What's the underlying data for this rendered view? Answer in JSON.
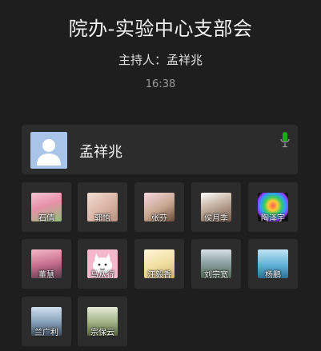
{
  "header": {
    "title": "院办-实验中心支部会",
    "host_line": "主持人：孟祥兆",
    "time": "16:38"
  },
  "host_card": {
    "name": "孟祥兆",
    "avatar_icon": "default-user-avatar-icon",
    "mic_icon": "microphone-icon",
    "mic_color": "#1aad19"
  },
  "participants": [
    {
      "name": "石倩"
    },
    {
      "name": "郭悟"
    },
    {
      "name": "张芬"
    },
    {
      "name": "侯月季"
    },
    {
      "name": "陶泽宇"
    },
    {
      "name": "董慧"
    },
    {
      "name": "马从行"
    },
    {
      "name": "汪毅香"
    },
    {
      "name": "刘宗宽"
    },
    {
      "name": "杨鹏"
    },
    {
      "name": "兰广利"
    },
    {
      "name": "宗保云"
    }
  ]
}
